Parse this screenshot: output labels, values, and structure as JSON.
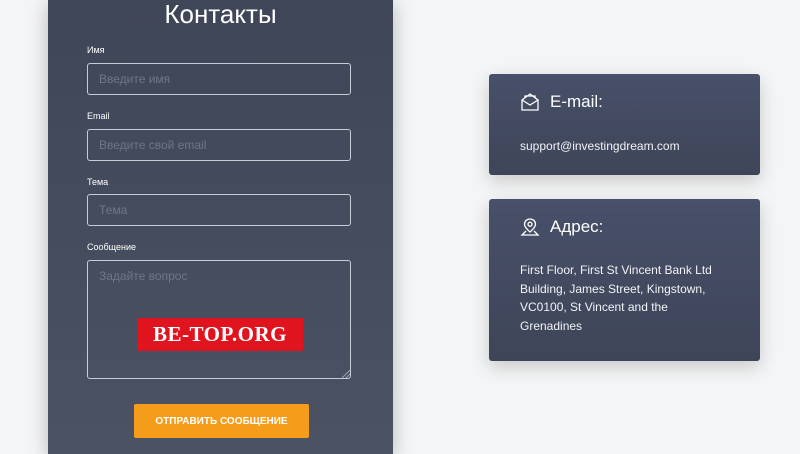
{
  "form": {
    "title": "Контакты",
    "name_label": "Имя",
    "name_placeholder": "Введите имя",
    "email_label": "Email",
    "email_placeholder": "Введите свой email",
    "subject_label": "Тема",
    "subject_placeholder": "Тема",
    "message_label": "Сообщение",
    "message_placeholder": "Задайте вопрос",
    "submit_label": "ОТПРАВИТЬ СООБЩЕНИЕ"
  },
  "watermark": {
    "text": "BE-TOP.ORG"
  },
  "email_card": {
    "title": "E-mail:",
    "icon": "envelope-icon",
    "value": "support@investingdream.com"
  },
  "address_card": {
    "title": "Адрес:",
    "icon": "map-pin-icon",
    "lines": [
      "First Floor, First St Vincent Bank Ltd",
      "Building, James Street, Kingstown,",
      "VC0100, St Vincent and the",
      "Grenadines"
    ]
  },
  "colors": {
    "panel": "#434a5c",
    "accent": "#f59c1a",
    "watermark": "#e0141e",
    "background": "#f4f5f6"
  }
}
